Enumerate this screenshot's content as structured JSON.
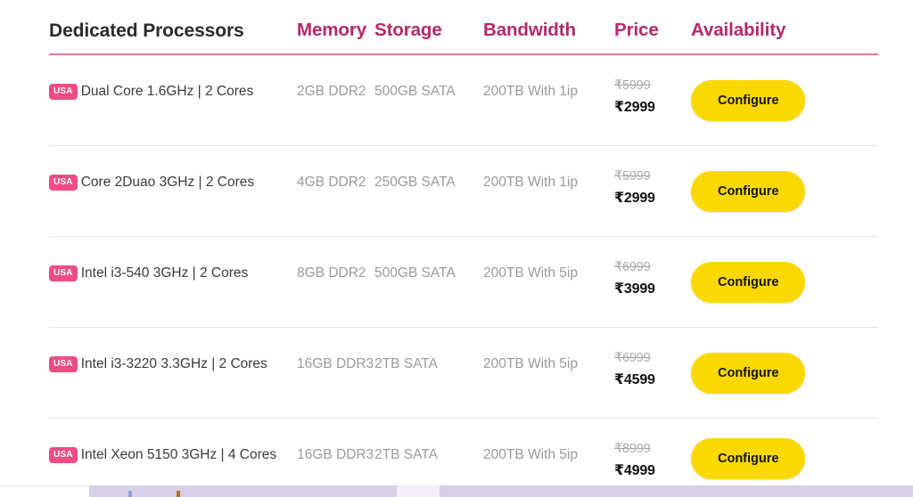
{
  "table": {
    "columns": [
      {
        "key": "processors",
        "label": "Dedicated Processors"
      },
      {
        "key": "memory",
        "label": "Memory"
      },
      {
        "key": "storage",
        "label": "Storage"
      },
      {
        "key": "bandwidth",
        "label": "Bandwidth"
      },
      {
        "key": "price",
        "label": "Price"
      },
      {
        "key": "availability",
        "label": "Availability"
      }
    ],
    "rows": [
      {
        "flag": "USA",
        "processor": "Dual Core 1.6GHz | 2 Cores",
        "memory": "2GB DDR2",
        "storage": "500GB SATA",
        "bandwidth": "200TB With 1ip",
        "price_old": "₹5999",
        "price_new": "₹2999",
        "action": "Configure"
      },
      {
        "flag": "USA",
        "processor": "Core 2Duao 3GHz | 2 Cores",
        "memory": "4GB DDR2",
        "storage": "250GB SATA",
        "bandwidth": "200TB With 1ip",
        "price_old": "₹5999",
        "price_new": "₹2999",
        "action": "Configure"
      },
      {
        "flag": "USA",
        "processor": "Intel i3-540 3GHz | 2 Cores",
        "memory": "8GB DDR2",
        "storage": "500GB SATA",
        "bandwidth": "200TB With 5ip",
        "price_old": "₹6999",
        "price_new": "₹3999",
        "action": "Configure"
      },
      {
        "flag": "USA",
        "processor": "Intel i3-3220 3.3GHz | 2 Cores",
        "memory": "16GB DDR3",
        "storage": "2TB SATA",
        "bandwidth": "200TB With 5ip",
        "price_old": "₹6999",
        "price_new": "₹4599",
        "action": "Configure"
      },
      {
        "flag": "USA",
        "processor": "Intel Xeon 5150 3GHz | 4 Cores",
        "memory": "16GB DDR3",
        "storage": "2TB SATA",
        "bandwidth": "200TB With 5ip",
        "price_old": "₹8999",
        "price_new": "₹4999",
        "action": "Configure"
      }
    ]
  },
  "colors": {
    "header_accent": "#b5286a",
    "header_rule": "#e8739f",
    "badge": "#f04c84",
    "button": "#fbd900",
    "processor_text": "#3b3b3b",
    "muted_text": "#9a9a9a",
    "price_new": "#111111"
  }
}
